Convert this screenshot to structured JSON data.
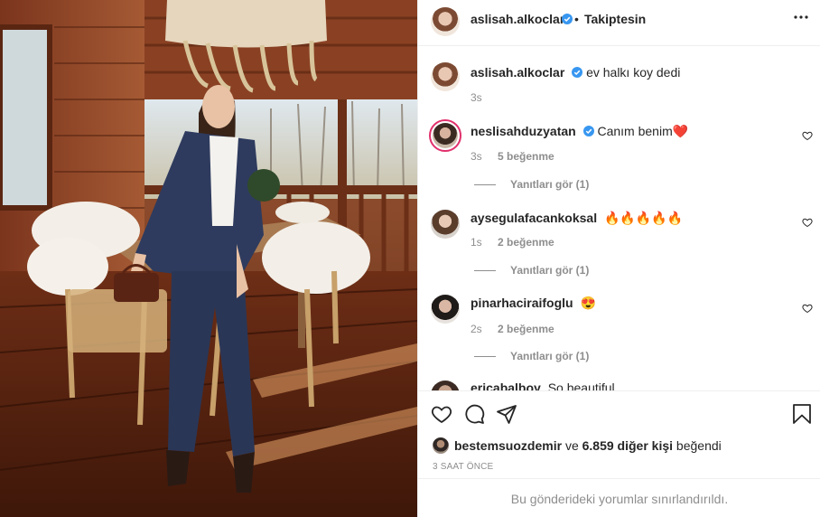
{
  "header": {
    "username": "aslisah.alkoclar",
    "separator": "•",
    "follow_status": "Takiptesin",
    "more_icon": "ellipsis-icon"
  },
  "caption": {
    "username": "aslisah.alkoclar",
    "text": "ev halkı koy dedi",
    "time": "3s"
  },
  "comments": [
    {
      "username": "neslisahduzyatan",
      "text": "Canım benim❤️",
      "time": "3s",
      "likes": "5 beğenme",
      "replies": "Yanıtları gör (1)",
      "ring": true
    },
    {
      "username": "aysegulafacankoksal",
      "text": "🔥🔥🔥🔥🔥",
      "time": "1s",
      "likes": "2 beğenme",
      "replies": "Yanıtları gör (1)",
      "ring": false
    },
    {
      "username": "pinarhaciraifoglu",
      "text": "😍",
      "time": "2s",
      "likes": "2 beğenme",
      "replies": "Yanıtları gör (1)",
      "ring": false
    },
    {
      "username": "ericabalboy",
      "text": "So beautiful",
      "time": "",
      "likes": "",
      "replies": "",
      "ring": false
    }
  ],
  "actions": {
    "like_icon": "heart-icon",
    "comment_icon": "comment-icon",
    "share_icon": "paper-plane-icon",
    "save_icon": "bookmark-icon"
  },
  "likes": {
    "liker": "bestemsuozdemir",
    "connector": "ve",
    "count": "6.859 diğer kişi",
    "suffix": "beğendi"
  },
  "post_time": "3 SAAT ÖNCE",
  "comments_limited": "Bu gönderideki yorumlar sınırlandırıldı.",
  "colors": {
    "verified": "#3897f0",
    "text": "#262626",
    "muted": "#8e8e8e",
    "heart_red": "#ed4956"
  }
}
